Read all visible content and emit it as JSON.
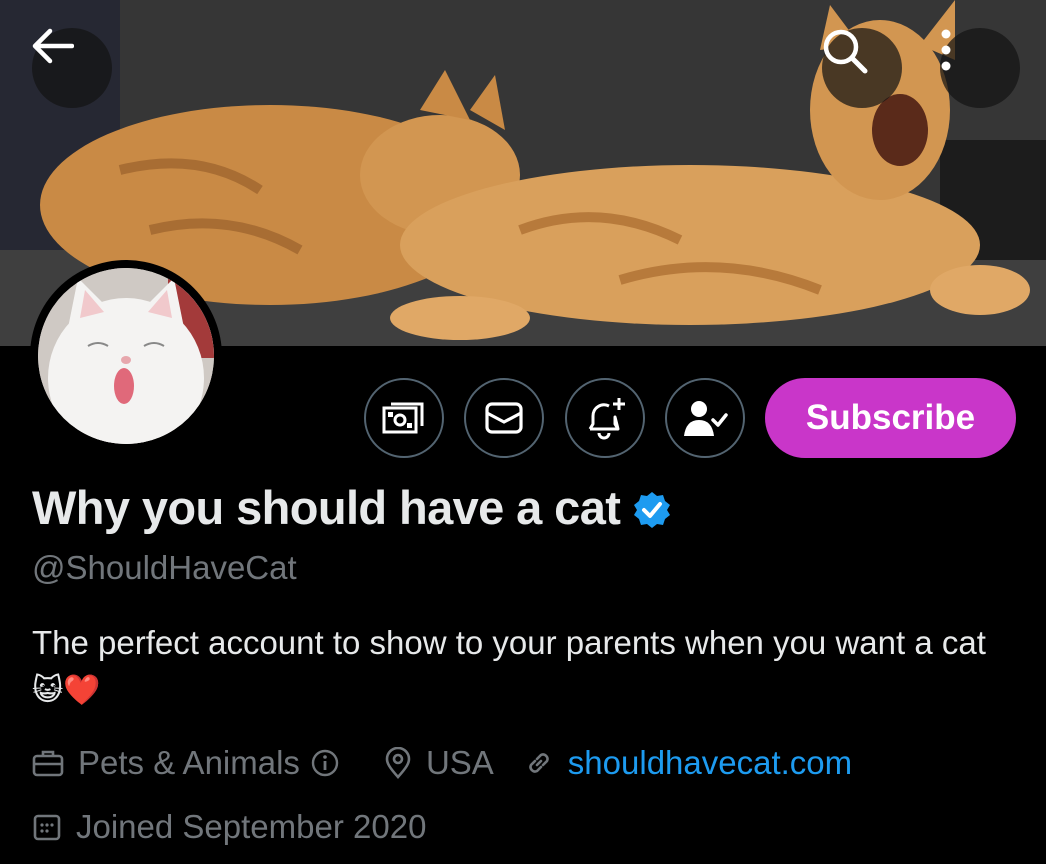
{
  "profile": {
    "display_name": "Why you should have a cat",
    "handle": "@ShouldHaveCat",
    "bio": "The perfect account to show to your parents when you want a cat",
    "bio_emojis": "😺❤️",
    "category": "Pets & Animals",
    "location": "USA",
    "website": "shouldhavecat.com",
    "joined": "Joined September 2020",
    "verified": true
  },
  "actions": {
    "subscribe_label": "Subscribe"
  },
  "colors": {
    "background": "#000000",
    "subscribe": "#c936c9",
    "verified_badge": "#1d9bf0",
    "link": "#1d9bf0",
    "muted_text": "#71767b"
  },
  "icons": [
    "back-arrow-icon",
    "search-icon",
    "more-vertical-icon",
    "money-icon",
    "mail-icon",
    "bell-plus-icon",
    "user-check-icon",
    "verified-badge-icon",
    "briefcase-icon",
    "info-icon",
    "location-pin-icon",
    "link-icon",
    "calendar-icon"
  ]
}
